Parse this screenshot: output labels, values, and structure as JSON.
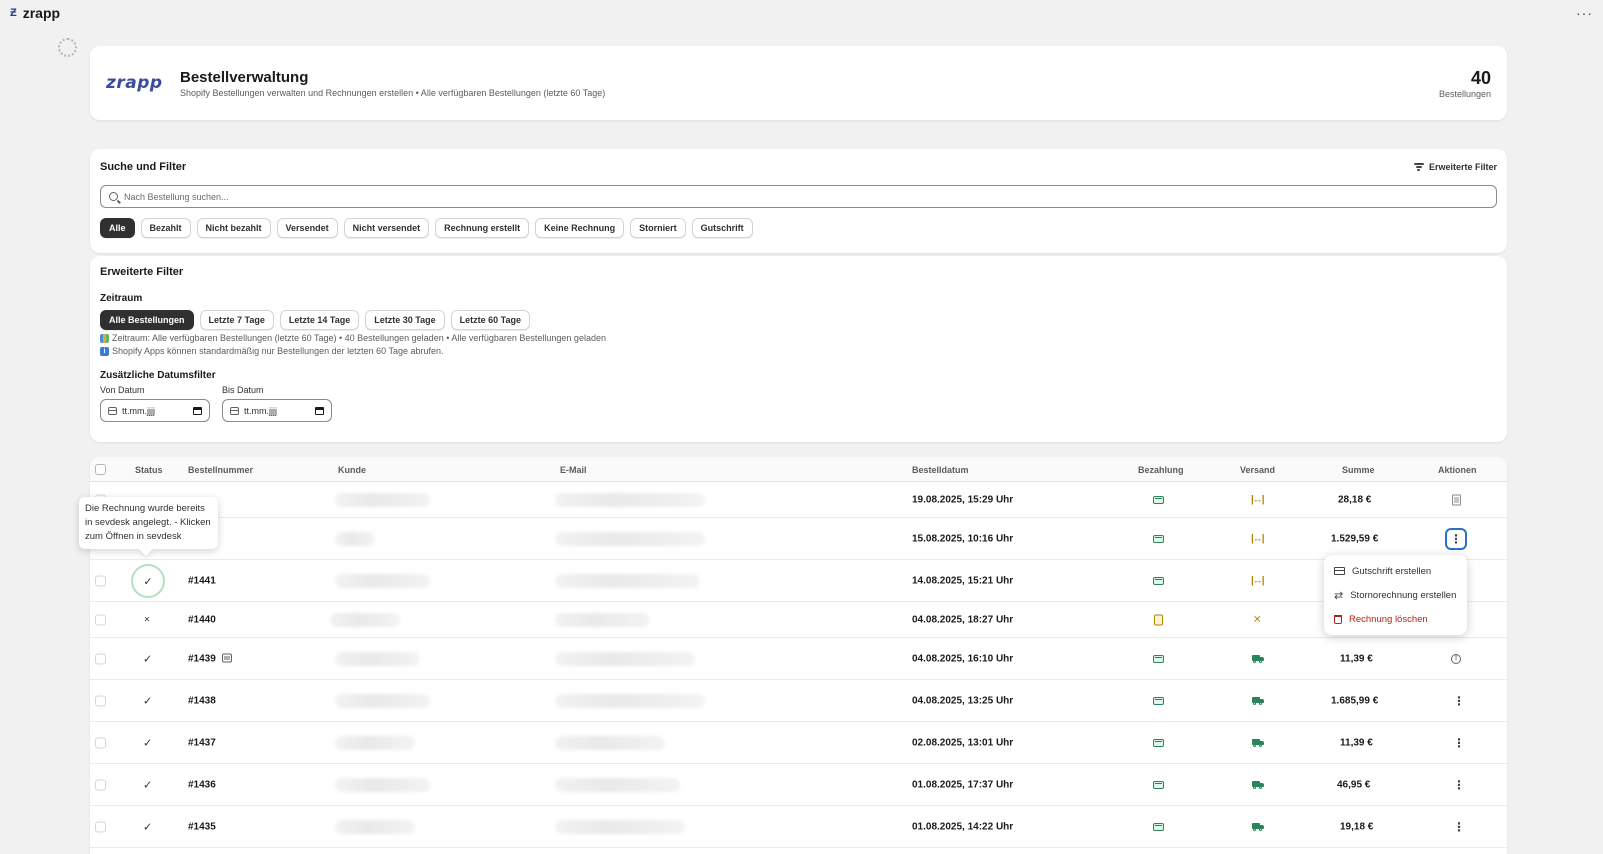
{
  "app": {
    "name": "zrapp",
    "logo": "zrapp",
    "more": "···"
  },
  "header": {
    "title": "Bestellverwaltung",
    "subtitle": "Shopify Bestellungen verwalten und Rechnungen erstellen • Alle verfügbaren Bestellungen (letzte 60 Tage)",
    "count": "40",
    "count_label": "Bestellungen"
  },
  "search": {
    "title": "Suche und Filter",
    "advanced_button": "Erweiterte Filter",
    "placeholder": "Nach Bestellung suchen...",
    "filters": [
      "Alle",
      "Bezahlt",
      "Nicht bezahlt",
      "Versendet",
      "Nicht versendet",
      "Rechnung erstellt",
      "Keine Rechnung",
      "Storniert",
      "Gutschrift"
    ],
    "active_filter": "Alle"
  },
  "advanced": {
    "title": "Erweiterte Filter",
    "period_title": "Zeitraum",
    "periods": [
      "Alle Bestellungen",
      "Letzte 7 Tage",
      "Letzte 14 Tage",
      "Letzte 30 Tage",
      "Letzte 60 Tage"
    ],
    "active_period": "Alle Bestellungen",
    "info1": "Zeitraum: Alle verfügbaren Bestellungen (letzte 60 Tage) • 40 Bestellungen geladen • Alle verfügbaren Bestellungen geladen",
    "info2": "Shopify Apps können standardmäßig nur Bestellungen der letzten 60 Tage abrufen.",
    "date_filter_title": "Zusätzliche Datumsfilter",
    "from_label": "Von Datum",
    "to_label": "Bis Datum",
    "date_placeholder": "tt.mm.jjjj"
  },
  "table": {
    "columns": [
      "Status",
      "Bestellnummer",
      "Kunde",
      "E-Mail",
      "Bestelldatum",
      "Bezahlung",
      "Versand",
      "Summe",
      "Aktionen"
    ],
    "rows": [
      {
        "status": "",
        "number": "",
        "date": "19.08.2025, 15:29 Uhr",
        "payment": "paid",
        "shipping": "pending",
        "total": "28,18 €",
        "action": "doc"
      },
      {
        "status": "",
        "number": "",
        "date": "15.08.2025, 10:16 Uhr",
        "payment": "paid",
        "shipping": "pending",
        "total": "1.529,59 €",
        "action": "menu-open"
      },
      {
        "status": "✓",
        "number": "#1441",
        "date": "14.08.2025, 15:21 Uhr",
        "payment": "paid",
        "shipping": "pending",
        "total": "",
        "action": ""
      },
      {
        "status": "×",
        "number": "#1440",
        "date": "04.08.2025, 18:27 Uhr",
        "payment": "pending",
        "shipping": "x",
        "total": "",
        "action": ""
      },
      {
        "status": "✓",
        "number": "#1439",
        "date": "04.08.2025, 16:10 Uhr",
        "payment": "paid",
        "shipping": "shipped",
        "total": "11,39 €",
        "action": "alert"
      },
      {
        "status": "✓",
        "number": "#1438",
        "date": "04.08.2025, 13:25 Uhr",
        "payment": "paid",
        "shipping": "shipped",
        "total": "1.685,99 €",
        "action": "dots"
      },
      {
        "status": "✓",
        "number": "#1437",
        "date": "02.08.2025, 13:01 Uhr",
        "payment": "paid",
        "shipping": "shipped",
        "total": "11,39 €",
        "action": "dots"
      },
      {
        "status": "✓",
        "number": "#1436",
        "date": "01.08.2025, 17:37 Uhr",
        "payment": "paid",
        "shipping": "shipped",
        "total": "46,95 €",
        "action": "dots"
      },
      {
        "status": "✓",
        "number": "#1435",
        "date": "01.08.2025, 14:22 Uhr",
        "payment": "paid",
        "shipping": "shipped",
        "total": "19,18 €",
        "action": "dots"
      }
    ]
  },
  "tooltip": {
    "text": "Die Rechnung wurde bereits in sevdesk angelegt. - Klicken zum Öffnen in sevdesk"
  },
  "menu": {
    "items": [
      {
        "label": "Gutschrift erstellen",
        "icon": "credit-card-icon"
      },
      {
        "label": "Stornorechnung erstellen",
        "icon": "swap-icon"
      },
      {
        "label": "Rechnung löschen",
        "icon": "trash-icon"
      }
    ]
  },
  "colors": {
    "accent": "#2c6ecb",
    "success": "#29845a",
    "warning": "#b28400",
    "danger": "#b42318"
  }
}
